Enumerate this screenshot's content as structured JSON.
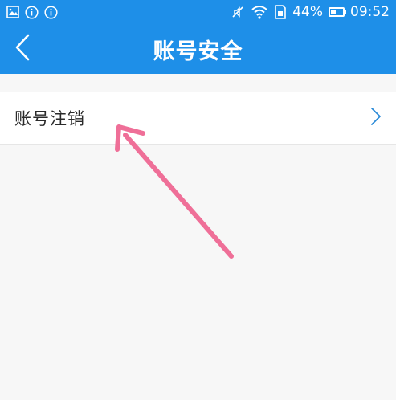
{
  "status_bar": {
    "battery_percent": 44,
    "battery_text": "44%",
    "time": "09:52",
    "icons": [
      "image-icon",
      "info-icon",
      "info-icon",
      "mute-icon",
      "wifi-icon",
      "sim-icon",
      "battery-icon"
    ]
  },
  "header": {
    "title": "账号安全",
    "back_icon": "chevron-left-icon"
  },
  "list": {
    "items": [
      {
        "label": "账号注销",
        "icon": "chevron-right-icon"
      }
    ]
  },
  "colors": {
    "accent": "#1e8fe8",
    "annotation_arrow": "#ef6f98",
    "chevron": "#2a8ad8"
  }
}
